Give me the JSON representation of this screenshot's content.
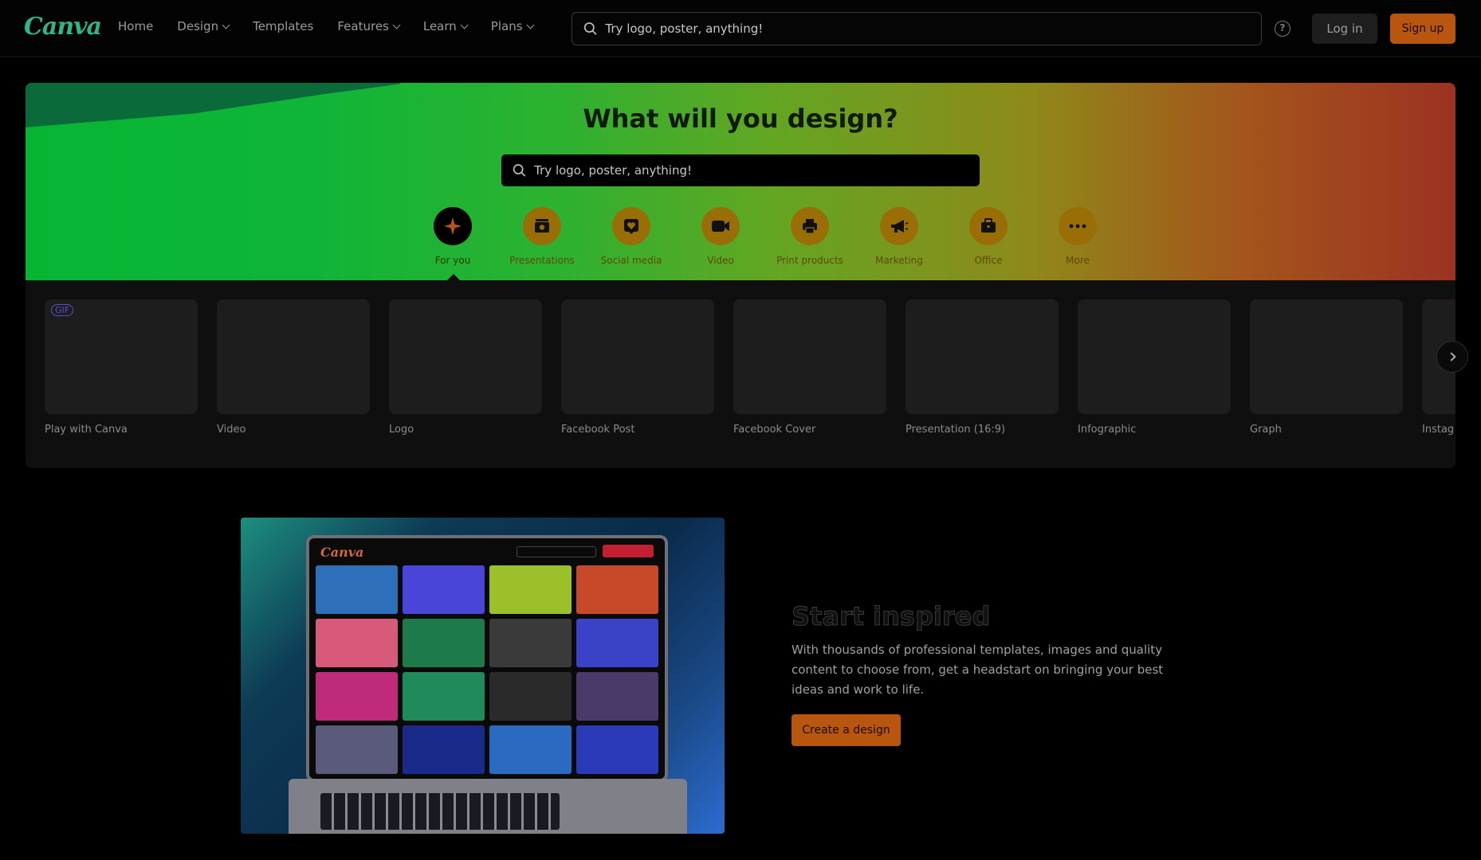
{
  "header": {
    "logo": "Canva",
    "nav": [
      {
        "label": "Home",
        "dropdown": false
      },
      {
        "label": "Design",
        "dropdown": true
      },
      {
        "label": "Templates",
        "dropdown": false
      },
      {
        "label": "Features",
        "dropdown": true
      },
      {
        "label": "Learn",
        "dropdown": true
      },
      {
        "label": "Plans",
        "dropdown": true
      }
    ],
    "search_placeholder": "Try logo, poster, anything!",
    "help_glyph": "?",
    "login_label": "Log in",
    "signup_label": "Sign up"
  },
  "hero": {
    "title": "What will you design?",
    "search_placeholder": "Try logo, poster, anything!",
    "categories": [
      {
        "label": "For you",
        "icon": "sparkle-icon",
        "active": true
      },
      {
        "label": "Presentations",
        "icon": "presentation-icon",
        "active": false
      },
      {
        "label": "Social media",
        "icon": "heart-icon",
        "active": false
      },
      {
        "label": "Video",
        "icon": "video-icon",
        "active": false
      },
      {
        "label": "Print products",
        "icon": "printer-icon",
        "active": false
      },
      {
        "label": "Marketing",
        "icon": "megaphone-icon",
        "active": false
      },
      {
        "label": "Office",
        "icon": "briefcase-icon",
        "active": false
      },
      {
        "label": "More",
        "icon": "more-icon",
        "active": false
      }
    ]
  },
  "cards": [
    {
      "label": "Play with Canva",
      "badge": "GIF"
    },
    {
      "label": "Video"
    },
    {
      "label": "Logo"
    },
    {
      "label": "Facebook Post"
    },
    {
      "label": "Facebook Cover"
    },
    {
      "label": "Presentation (16:9)"
    },
    {
      "label": "Infographic"
    },
    {
      "label": "Graph"
    },
    {
      "label": "Instag"
    }
  ],
  "promo": {
    "title": "Start inspired",
    "text": "With thousands of professional templates, images and quality content to choose from, get a headstart on bringing your best ideas and work to life.",
    "cta_label": "Create a design",
    "mini_logo": "Canva"
  },
  "colors": {
    "accent": "#b8560f",
    "brand_logo": "#2eb58a"
  }
}
